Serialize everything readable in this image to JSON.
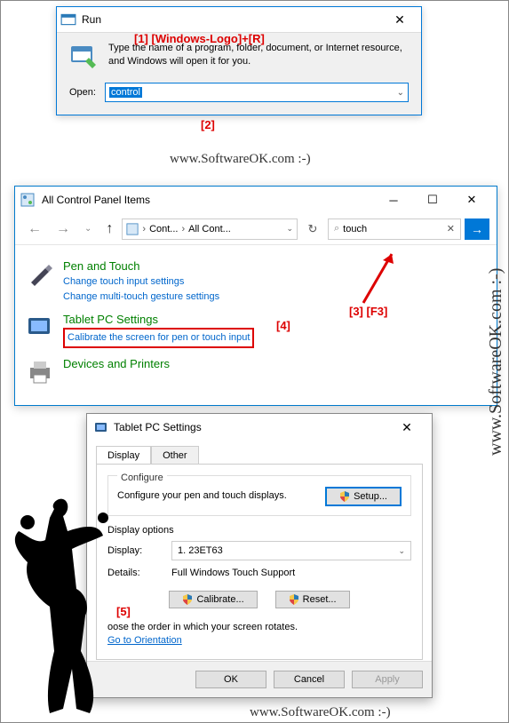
{
  "annotations": {
    "a1": "[1]  [Windows-Logo]+[R]",
    "a2": "[2]",
    "a3": "[3] [F3]",
    "a4": "[4]",
    "a5": "[5]"
  },
  "watermark": {
    "side": "www.SoftwareOK.com :-)",
    "url1": "www.SoftwareOK.com :-)",
    "url2": "www.SoftwareOK.com :-)",
    "faint": "SoftwareOK"
  },
  "run": {
    "title": "Run",
    "desc": "Type the name of a program, folder, document, or Internet resource, and Windows will open it for you.",
    "open_label": "Open:",
    "open_value": "control"
  },
  "cp": {
    "title": "All Control Panel Items",
    "addr_seg1": "Cont...",
    "addr_seg2": "All Cont...",
    "search_value": "touch",
    "cats": [
      {
        "title": "Pen and Touch",
        "links": [
          "Change touch input settings",
          "Change multi-touch gesture settings"
        ]
      },
      {
        "title": "Tablet PC Settings",
        "links": [
          "Calibrate the screen for pen or touch input"
        ]
      },
      {
        "title": "Devices and Printers",
        "links": []
      }
    ]
  },
  "tablet": {
    "title": "Tablet PC Settings",
    "tabs": {
      "display": "Display",
      "other": "Other"
    },
    "configure_legend": "Configure",
    "configure_text": "Configure your pen and touch displays.",
    "setup_btn": "Setup...",
    "display_options": "Display options",
    "display_label": "Display:",
    "display_value": "1. 23ET63",
    "details_label": "Details:",
    "details_value": "Full Windows Touch Support",
    "calibrate_btn": "Calibrate...",
    "reset_btn": "Reset...",
    "order_text": "oose the order in which your screen rotates.",
    "orientation_link": "Go to Orientation",
    "ok": "OK",
    "cancel": "Cancel",
    "apply": "Apply"
  }
}
